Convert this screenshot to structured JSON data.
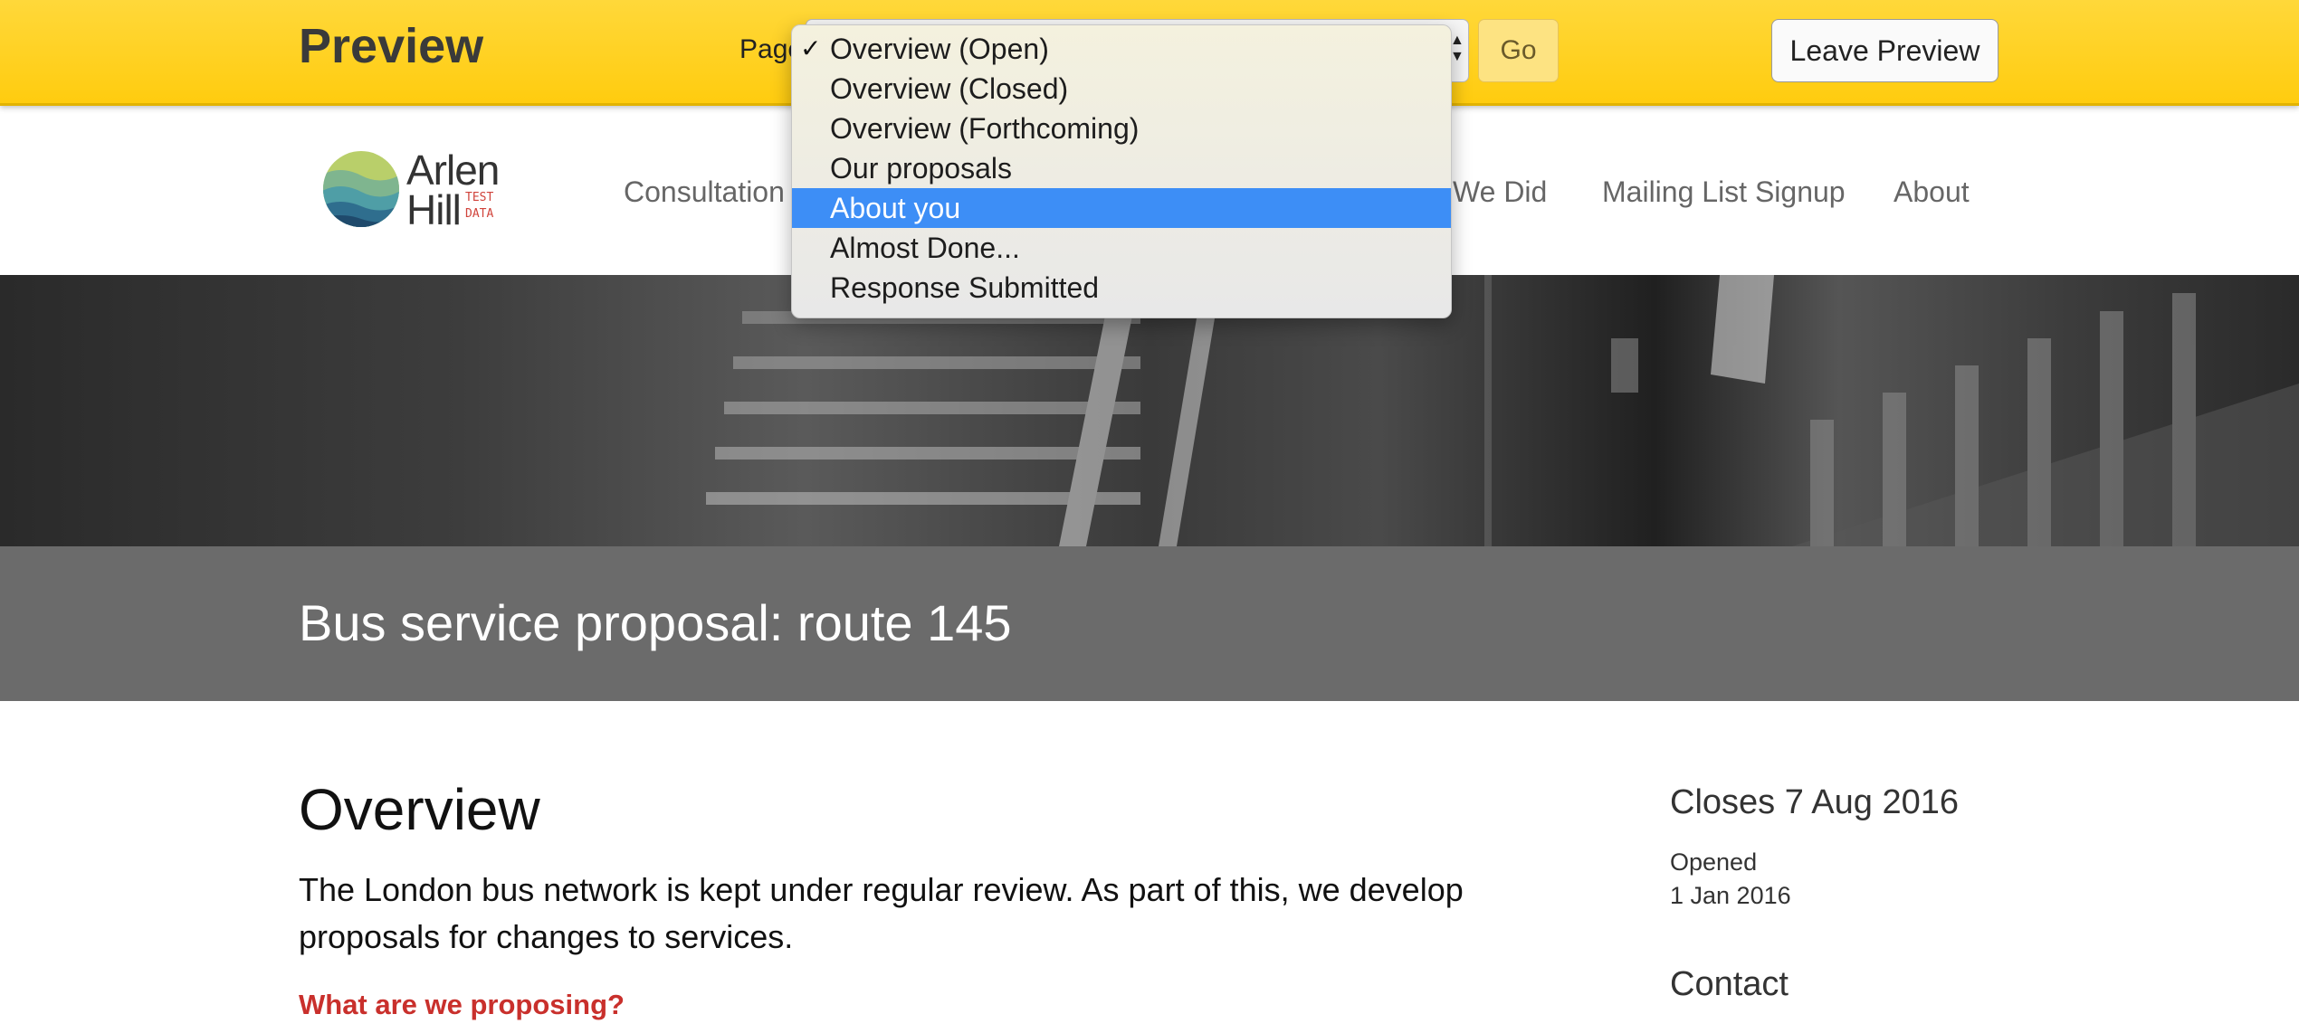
{
  "preview_bar": {
    "title": "Preview",
    "page_label": "Page",
    "go_label": "Go",
    "leave_label": "Leave Preview"
  },
  "dropdown": {
    "options": [
      "Overview (Open)",
      "Overview (Closed)",
      "Overview (Forthcoming)",
      "Our proposals",
      "About you",
      "Almost Done...",
      "Response Submitted"
    ],
    "checked": "Overview (Open)",
    "highlighted": "About you"
  },
  "logo": {
    "line1": "Arlen",
    "line2": "Hill",
    "test_line1": "TEST",
    "test_line2": "DATA"
  },
  "nav": {
    "consultations": "Consultation",
    "we_did": "We Did",
    "mailing_list": "Mailing List Signup",
    "about": "About"
  },
  "page_title": "Bus service proposal: route 145",
  "main": {
    "heading": "Overview",
    "intro": "The London bus network is kept under regular review. As part of this, we develop proposals for changes to services.",
    "subheading": "What are we proposing?"
  },
  "sidebar": {
    "closes": "Closes 7 Aug 2016",
    "opened_label": "Opened",
    "opened_date": "1 Jan 2016",
    "contact_heading": "Contact"
  },
  "colors": {
    "preview_yellow": "#ffd21e",
    "highlight_blue": "#3d8ef6",
    "accent_red": "#c9302c",
    "title_band": "#6b6b6b"
  }
}
